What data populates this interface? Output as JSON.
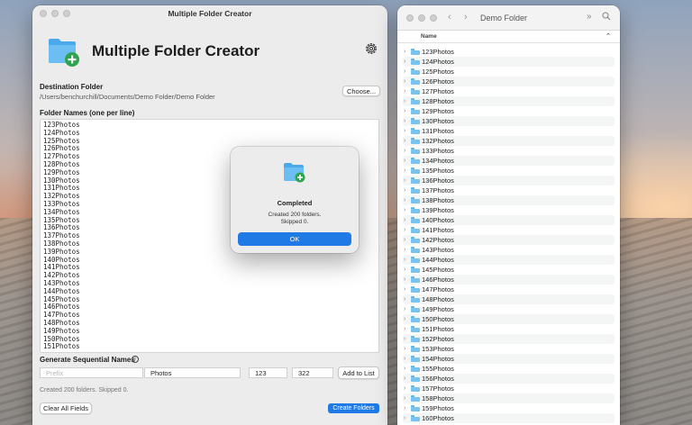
{
  "main_window": {
    "title": "Multiple Folder Creator",
    "app_title": "Multiple Folder Creator",
    "destination_label": "Destination Folder",
    "destination_path": "/Users/benchurchill/Documents/Demo Folder/Demo Folder",
    "choose_button": "Choose...",
    "names_label": "Folder Names (one per line)",
    "folder_names": [
      "123Photos",
      "124Photos",
      "125Photos",
      "126Photos",
      "127Photos",
      "128Photos",
      "129Photos",
      "130Photos",
      "131Photos",
      "132Photos",
      "133Photos",
      "134Photos",
      "135Photos",
      "136Photos",
      "137Photos",
      "138Photos",
      "139Photos",
      "140Photos",
      "141Photos",
      "142Photos",
      "143Photos",
      "144Photos",
      "145Photos",
      "146Photos",
      "147Photos",
      "148Photos",
      "149Photos",
      "150Photos",
      "151Photos"
    ],
    "sequential_label": "Generate Sequential Names",
    "prefix_placeholder": "Prefix",
    "suffix_value": "Photos",
    "start_value": "123",
    "end_value": "322",
    "add_to_list_button": "Add to List",
    "status_text": "Created 200 folders. Skipped 0.",
    "clear_button": "Clear All Fields",
    "create_button": "Create Folders"
  },
  "dialog": {
    "title": "Completed",
    "message_line1": "Created 200 folders.",
    "message_line2": "Skipped 0.",
    "ok_button": "OK"
  },
  "finder": {
    "title": "Demo Folder",
    "column_name": "Name",
    "items": [
      "123Photos",
      "124Photos",
      "125Photos",
      "126Photos",
      "127Photos",
      "128Photos",
      "129Photos",
      "130Photos",
      "131Photos",
      "132Photos",
      "133Photos",
      "134Photos",
      "135Photos",
      "136Photos",
      "137Photos",
      "138Photos",
      "139Photos",
      "140Photos",
      "141Photos",
      "142Photos",
      "143Photos",
      "144Photos",
      "145Photos",
      "146Photos",
      "147Photos",
      "148Photos",
      "149Photos",
      "150Photos",
      "151Photos",
      "152Photos",
      "153Photos",
      "154Photos",
      "155Photos",
      "156Photos",
      "157Photos",
      "158Photos",
      "159Photos",
      "160Photos"
    ]
  },
  "icons": {
    "app": "folder-plus-icon",
    "settings": "gear-icon",
    "info": "info-icon",
    "folder": "folder-icon",
    "disclosure": "chevron-right-icon"
  },
  "colors": {
    "accent": "#1f7ae6",
    "folder": "#79c3f2",
    "badge": "#2ea44f"
  }
}
